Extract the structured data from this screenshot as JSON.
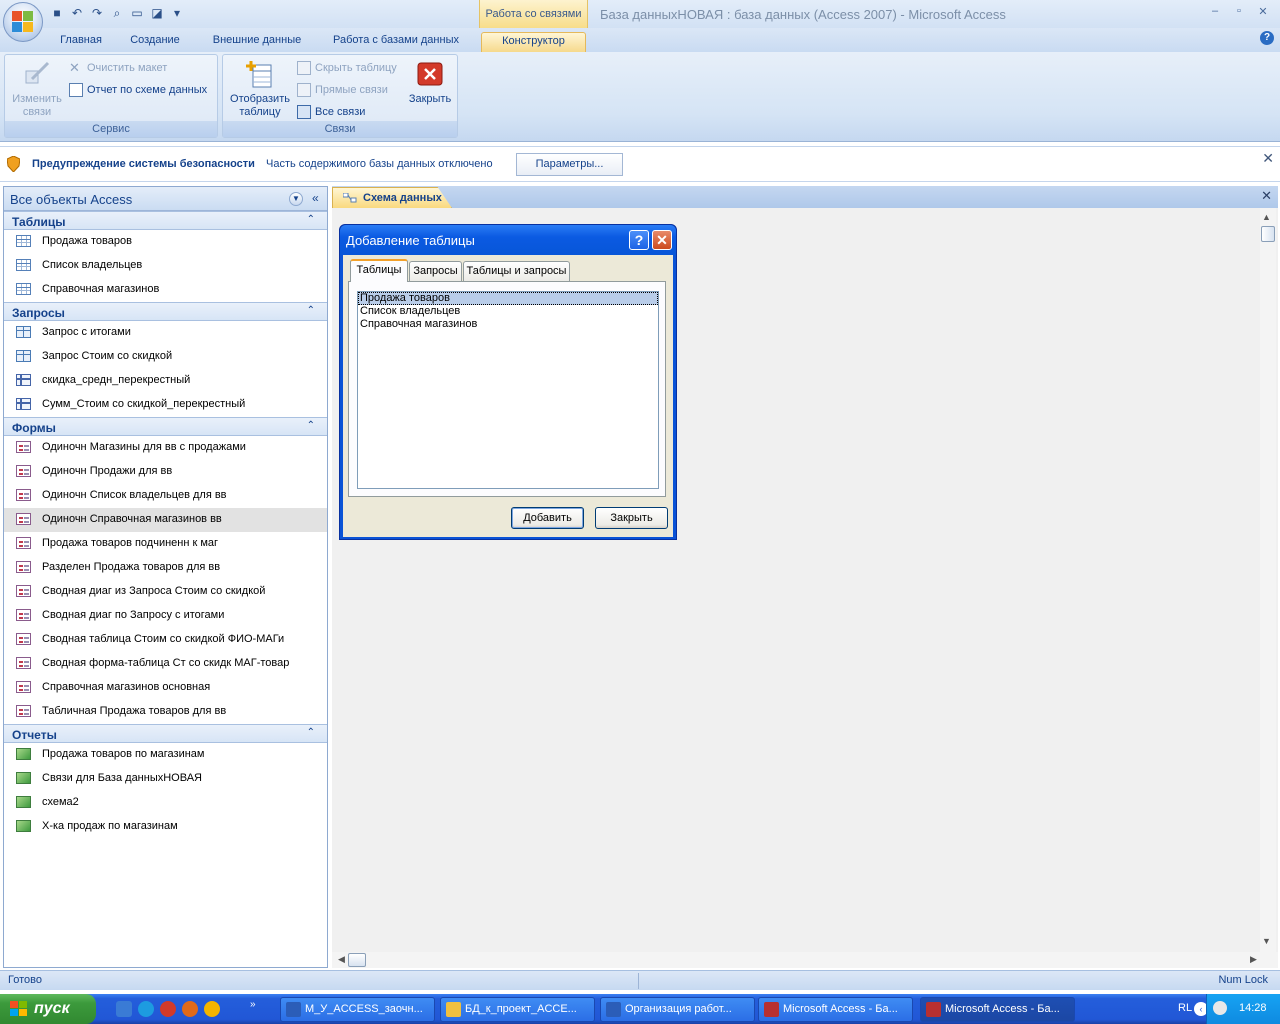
{
  "window": {
    "contextual_tab_group": "Работа со связями",
    "title": "База данныхНОВАЯ : база данных (Access 2007) - Microsoft Access"
  },
  "ribbon": {
    "tabs": [
      {
        "label": "Главная"
      },
      {
        "label": "Создание"
      },
      {
        "label": "Внешние данные"
      },
      {
        "label": "Работа с базами данных"
      },
      {
        "label": "Конструктор",
        "active": true
      }
    ],
    "groups": {
      "service": {
        "label": "Сервис",
        "edit_relations": "Изменить связи",
        "clear_layout": "Очистить макет",
        "relations_report": "Отчет по схеме данных"
      },
      "relations": {
        "label": "Связи",
        "show_table": "Отобразить таблицу",
        "hide_table": "Скрыть таблицу",
        "direct_relations": "Прямые связи",
        "all_relations": "Все связи",
        "close": "Закрыть"
      }
    }
  },
  "security_bar": {
    "title": "Предупреждение системы безопасности",
    "message": "Часть содержимого базы данных отключено",
    "options_button": "Параметры..."
  },
  "nav": {
    "header": "Все объекты Access",
    "groups": [
      {
        "label": "Таблицы",
        "icon": "table",
        "items": [
          {
            "label": "Продажа товаров"
          },
          {
            "label": "Список владельцев"
          },
          {
            "label": "Справочная магазинов"
          }
        ]
      },
      {
        "label": "Запросы",
        "icon": "query",
        "items": [
          {
            "label": "Запрос с итогами",
            "icon": "query"
          },
          {
            "label": "Запрос Стоим со скидкой",
            "icon": "query"
          },
          {
            "label": "скидка_средн_перекрестный",
            "icon": "crosstab"
          },
          {
            "label": "Сумм_Стоим со скидкой_перекрестный",
            "icon": "crosstab"
          }
        ]
      },
      {
        "label": "Формы",
        "icon": "form",
        "items": [
          {
            "label": "Одиночн Магазины для вв с продажами"
          },
          {
            "label": "Одиночн Продажи для вв"
          },
          {
            "label": "Одиночн Список владельцев для вв"
          },
          {
            "label": "Одиночн Справочная магазинов вв",
            "selected": true
          },
          {
            "label": "Продажа товаров подчиненн к маг"
          },
          {
            "label": "Разделен Продажа товаров для вв"
          },
          {
            "label": "Сводная диаг из Запроса Стоим со скидкой"
          },
          {
            "label": "Сводная диаг по Запросу с итогами"
          },
          {
            "label": "Сводная таблица Стоим со скидкой ФИО-МАГи"
          },
          {
            "label": "Сводная форма-таблица Ст со скидк МАГ-товар"
          },
          {
            "label": "Справочная магазинов основная"
          },
          {
            "label": "Табличная Продажа товаров для вв"
          }
        ]
      },
      {
        "label": "Отчеты",
        "icon": "report",
        "items": [
          {
            "label": "Продажа товаров по магазинам"
          },
          {
            "label": "Связи для База данныхНОВАЯ"
          },
          {
            "label": "схема2"
          },
          {
            "label": "Х-ка продаж по магазинам"
          }
        ]
      }
    ]
  },
  "document": {
    "tab_label": "Схема данных"
  },
  "dialog": {
    "title": "Добавление таблицы",
    "tabs": [
      "Таблицы",
      "Запросы",
      "Таблицы и запросы"
    ],
    "list": [
      "Продажа товаров",
      "Список владельцев",
      "Справочная магазинов"
    ],
    "add_button": "Добавить",
    "close_button": "Закрыть"
  },
  "status": {
    "left": "Готово",
    "right": "Num Lock"
  },
  "taskbar": {
    "start": "пуск",
    "buttons": [
      {
        "label": "М_У_ACCESS_заочн...",
        "icon_color": "#2b5db8"
      },
      {
        "label": "БД_к_проект_ACCE...",
        "icon_color": "#f0c040"
      },
      {
        "label": "Организация работ...",
        "icon_color": "#2b5db8"
      },
      {
        "label": "Microsoft Access - Ба...",
        "icon_color": "#b83030"
      },
      {
        "label": "Microsoft Access - Ба...",
        "icon_color": "#b83030",
        "active": true
      }
    ],
    "language": "RL",
    "time": "14:28"
  }
}
